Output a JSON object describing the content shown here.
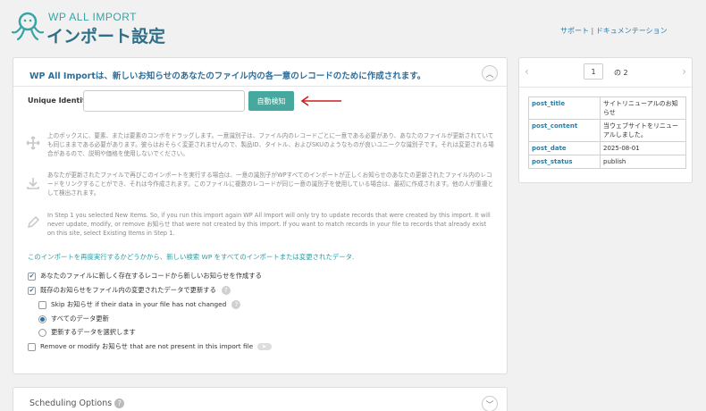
{
  "header": {
    "brand_small": "WP ALL IMPORT",
    "brand_big": "インポート設定",
    "support_link": "サポート",
    "separator": "|",
    "docs_link": "ドキュメンテーション"
  },
  "main": {
    "title": "WP All Importは、新しいお知らせのあなたのファイル内の各一意のレコードのために作成されます。",
    "collapse_glyph": "︿",
    "uid_label": "Unique Identifier",
    "uid_value": "",
    "auto_button": "自動検知",
    "info1": "上のボックスに、要素、または要素のコンボをドラッグします。一意識別子は、ファイル内のレコードごとに一意である必要があり、あなたのファイルが更新されていても同じままである必要があります。彼らはおそらく変更されませんので、製品ID、タイトル、およびSKUのようなものが良いユニークな識別子です。それは変更される場合があるので、説明や価格を使用しないでください。",
    "info2": "あなたが更新されたファイルで再びこのインポートを実行する場合は、一意の識別子がWPすべてのインポートが正しくお知らせのあなたの更新されたファイル内のレコードをリンクすることができ、それは今作成されます。このファイルに複数のレコードが同じ一意の識別子を使用している場合は、最初に作成されます。他の人が重複として検出されます。",
    "info3": "In Step 1 you selected New Items. So, if you run this import again WP All Import will only try to update records that were created by this import. It will never update, modify, or remove お知らせ that were not created by this import. If you want to match records in your file to records that already exist on this site, select Existing Items in Step 1.",
    "rerun_link": "このインポートを再度実行するかどうかから、新しい検索 WP をすべてのインポートまたは変更されたデータ.",
    "options": {
      "create_new": "あなたのファイルに新しく存在するレコードから新しいお知らせを作成する",
      "update_existing": "既存のお知らせをファイル内の変更されたデータで更新する",
      "skip_unchanged": "Skip お知らせ if their data in your file has not changed",
      "update_all": "すべてのデータ更新",
      "choose_data": "更新するデータを選択します",
      "remove_missing": "Remove or modify お知らせ that are not present in this import file"
    }
  },
  "scheduling": {
    "title": "Scheduling Options",
    "help_glyph": "?",
    "expand_glyph": "﹀"
  },
  "preview": {
    "prev_glyph": "‹",
    "next_glyph": "›",
    "current_page": "1",
    "of_text": "の 2",
    "fields": [
      {
        "key": "post_title",
        "value": "サイトリニューアルのお知らせ"
      },
      {
        "key": "post_content",
        "value": "当ウェブサイトをリニューアルしました。"
      },
      {
        "key": "post_date",
        "value": "2025-08-01"
      },
      {
        "key": "post_status",
        "value": "publish"
      }
    ]
  },
  "colors": {
    "accent": "#46a9a0",
    "title_blue": "#2a6fa0",
    "arrow_red": "#cc1f1f"
  }
}
